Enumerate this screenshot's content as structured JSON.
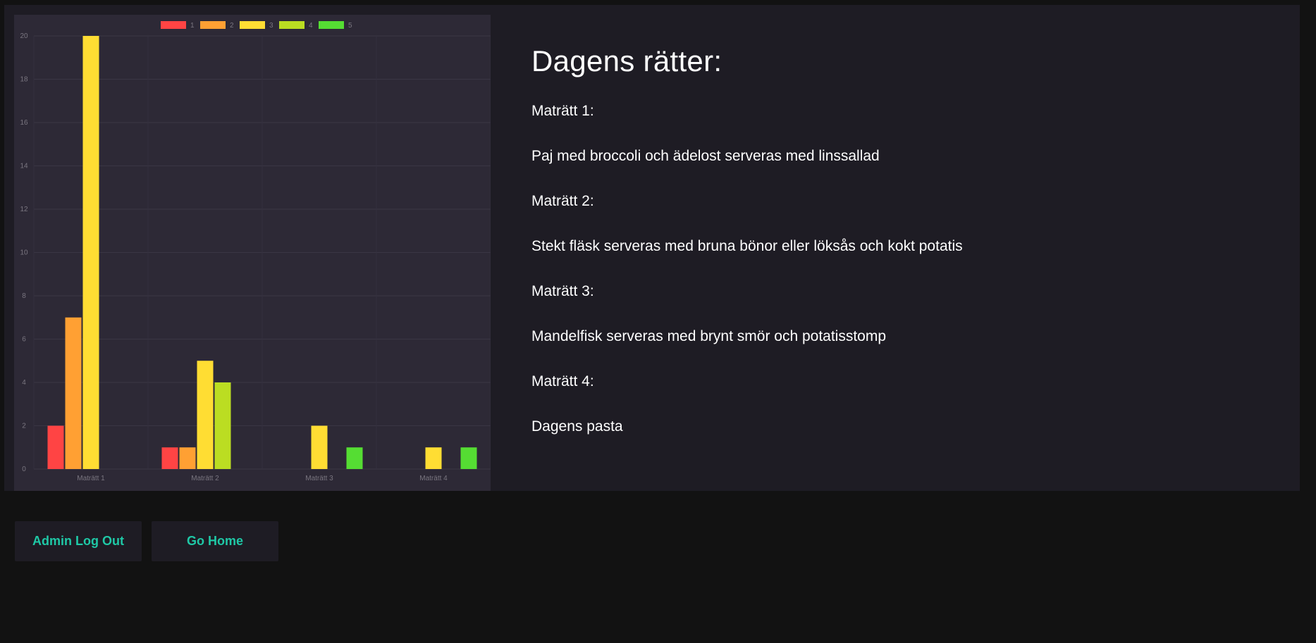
{
  "menu": {
    "title": "Dagens rätter:",
    "dishes": [
      {
        "label": "Maträtt 1:",
        "description": "Paj med broccoli och ädelost serveras med linssallad"
      },
      {
        "label": "Maträtt 2:",
        "description": "Stekt fläsk serveras med bruna bönor eller löksås och kokt potatis"
      },
      {
        "label": "Maträtt 3:",
        "description": "Mandelfisk serveras med brynt smör och potatisstomp"
      },
      {
        "label": "Maträtt 4:",
        "description": "Dagens pasta"
      }
    ]
  },
  "buttons": {
    "logout_label": "Admin Log Out",
    "home_label": "Go Home"
  },
  "colors": {
    "accent": "#1fc8a6",
    "panel": "#1e1c24",
    "chart_bg": "#2d2936",
    "page_bg": "#121212"
  },
  "chart_data": {
    "type": "bar",
    "categories": [
      "Maträtt 1",
      "Maträtt 2",
      "Maträtt 3",
      "Maträtt 4"
    ],
    "series": [
      {
        "name": "1",
        "color": "#ff4444",
        "values": [
          2,
          1,
          0,
          0
        ]
      },
      {
        "name": "2",
        "color": "#ffa033",
        "values": [
          7,
          1,
          0,
          0
        ]
      },
      {
        "name": "3",
        "color": "#ffdd33",
        "values": [
          20,
          5,
          2,
          1
        ]
      },
      {
        "name": "4",
        "color": "#bbdd22",
        "values": [
          0,
          4,
          0,
          0
        ]
      },
      {
        "name": "5",
        "color": "#55dd33",
        "values": [
          0,
          0,
          1,
          1
        ]
      }
    ],
    "ylim": [
      0,
      20
    ],
    "yticks": [
      0,
      2,
      4,
      6,
      8,
      10,
      12,
      14,
      16,
      18,
      20
    ],
    "grid": true,
    "legend": "top-center"
  }
}
